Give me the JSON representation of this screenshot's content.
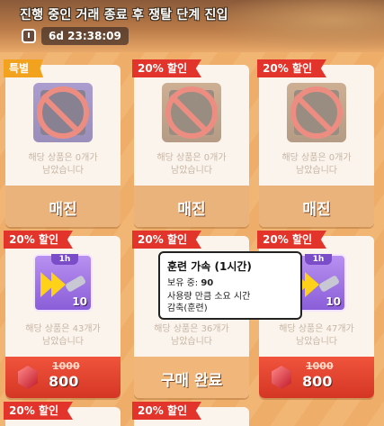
{
  "banner": {
    "title": "진행 중인 거래 종료 후 쟁탈 단계 진입",
    "timer": "6d 23:38:09"
  },
  "cards": [
    {
      "badge": "특별",
      "badge_color": "#f2a21c",
      "remain": "해당 상품은 0개가\n남았습니다",
      "footer": "매진",
      "state": "sold_out"
    },
    {
      "badge": "20% 할인",
      "badge_color": "#e2342a",
      "remain": "해당 상품은 0개가\n남았습니다",
      "footer": "매진",
      "state": "sold_out"
    },
    {
      "badge": "20% 할인",
      "badge_color": "#e2342a",
      "remain": "해당 상품은 0개가\n남았습니다",
      "footer": "매진",
      "state": "sold_out"
    },
    {
      "badge": "20% 할인",
      "badge_color": "#e2342a",
      "remain": "해당 상품은 43개가\n남았습니다",
      "item_tag": "1h",
      "item_qty": "10",
      "old_price": "1000",
      "price": "800",
      "state": "buy"
    },
    {
      "badge": "20% 할인",
      "badge_color": "#e2342a",
      "remain": "해당 상품은 36개가\n남았습니다",
      "footer": "구매 완료",
      "state": "purchased"
    },
    {
      "badge": "20% 할인",
      "badge_color": "#e2342a",
      "remain": "해당 상품은 47개가\n남았습니다",
      "item_tag": "1h",
      "item_qty": "10",
      "old_price": "1000",
      "price": "800",
      "state": "buy"
    },
    {
      "badge": "20% 할인",
      "badge_color": "#e2342a"
    },
    {
      "badge": "20% 할인",
      "badge_color": "#e2342a"
    }
  ],
  "tooltip": {
    "title": "훈련 가속 (1시간)",
    "owned_label": "보유 중:",
    "owned_value": "90",
    "desc_line1": "사용량 만큼 소요 시간",
    "desc_line2": "감축(훈련)"
  }
}
